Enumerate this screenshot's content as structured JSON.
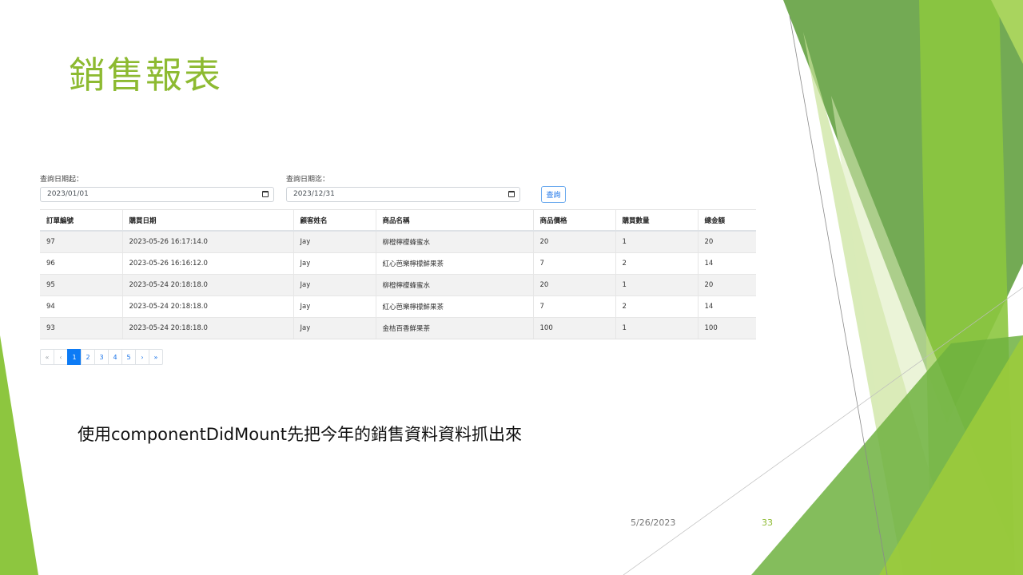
{
  "slide": {
    "title": "銷售報表",
    "caption": "使用componentDidMount先把今年的銷售資料資料抓出來",
    "footer_date": "5/26/2023",
    "slide_number": "33",
    "accent_color": "#8dba31"
  },
  "query_form": {
    "start_label": "查詢日期起：",
    "start_value": "2023/01/01",
    "end_label": "查詢日期迄：",
    "end_value": "2023/12/31",
    "calendar_icon": "calendar-icon",
    "submit_label": "查詢"
  },
  "table": {
    "columns": [
      "訂單編號",
      "購買日期",
      "顧客姓名",
      "商品名稱",
      "商品價格",
      "購買數量",
      "總金額"
    ],
    "rows": [
      [
        "97",
        "2023-05-26 16:17:14.0",
        "Jay",
        "柳橙檸檬蜂蜜水",
        "20",
        "1",
        "20"
      ],
      [
        "96",
        "2023-05-26 16:16:12.0",
        "Jay",
        "紅心芭樂檸檬鮮果茶",
        "7",
        "2",
        "14"
      ],
      [
        "95",
        "2023-05-24 20:18:18.0",
        "Jay",
        "柳橙檸檬蜂蜜水",
        "20",
        "1",
        "20"
      ],
      [
        "94",
        "2023-05-24 20:18:18.0",
        "Jay",
        "紅心芭樂檸檬鮮果茶",
        "7",
        "2",
        "14"
      ],
      [
        "93",
        "2023-05-24 20:18:18.0",
        "Jay",
        "金桔百香鮮果茶",
        "100",
        "1",
        "100"
      ]
    ]
  },
  "pagination": {
    "first": "«",
    "prev": "‹",
    "pages": [
      "1",
      "2",
      "3",
      "4",
      "5"
    ],
    "active_page": "1",
    "next": "›",
    "last": "»"
  }
}
